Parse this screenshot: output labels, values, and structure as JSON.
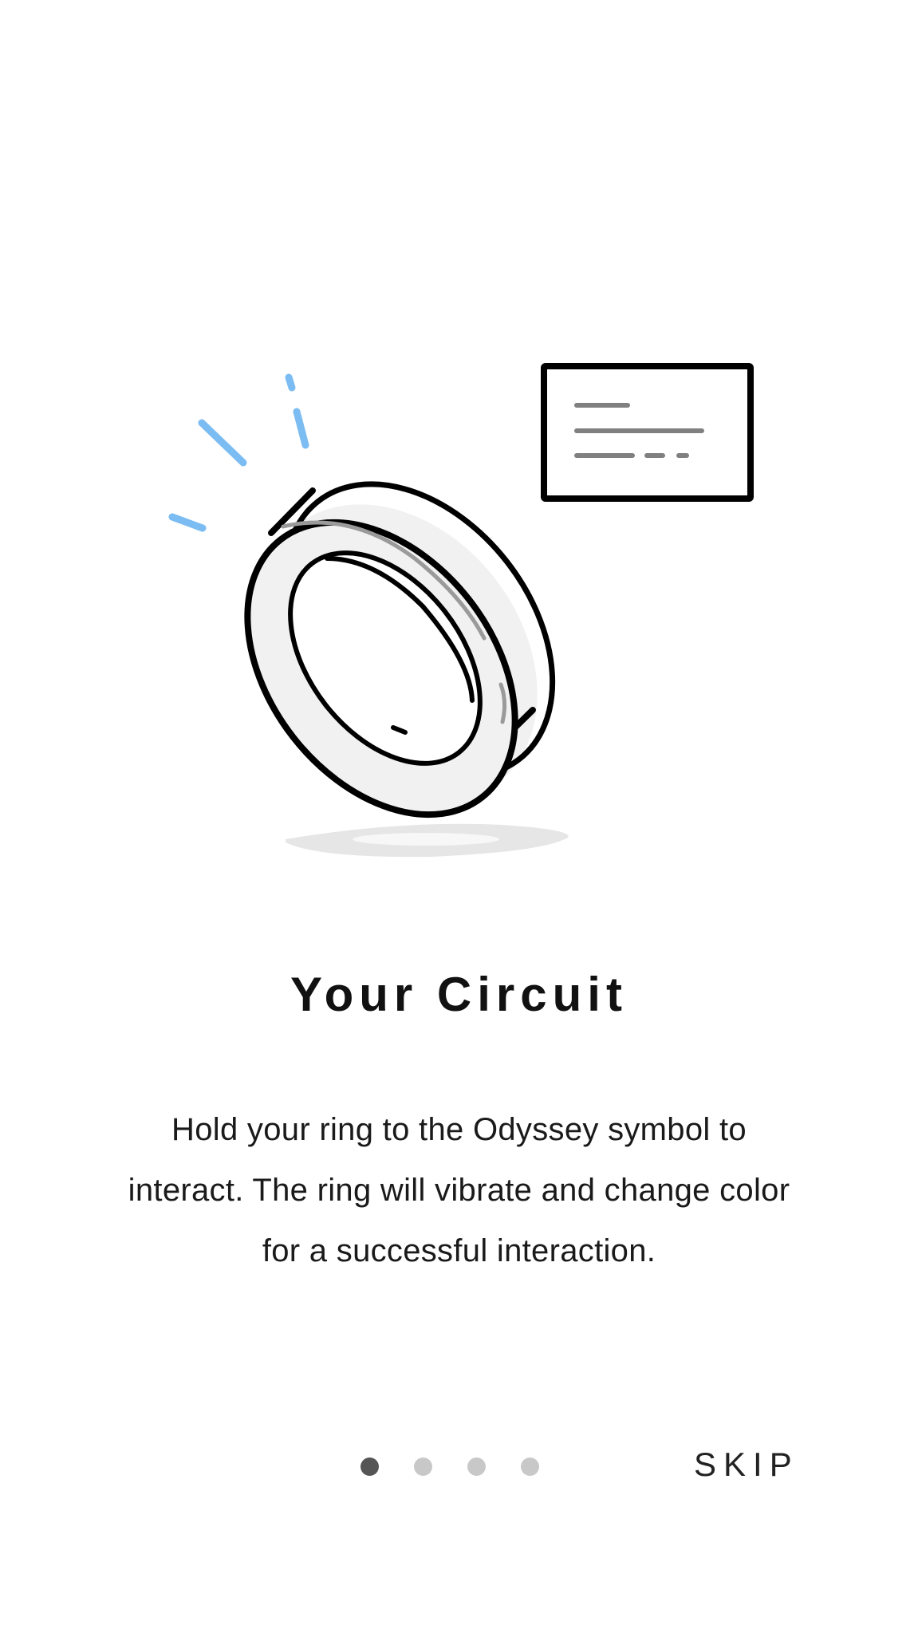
{
  "onboarding": {
    "title": "Your Circuit",
    "body": "Hold your ring to the Odyssey symbol to interact. The ring will vibrate and change color for a successful interaction.",
    "skip_label": "SKIP",
    "pager": {
      "total_pages": 4,
      "current_page": 1
    },
    "illustration": {
      "accent_color": "#7bbcf2",
      "icons": [
        "ring-icon",
        "card-icon",
        "vibration-lines-icon",
        "shadow-icon"
      ]
    }
  }
}
